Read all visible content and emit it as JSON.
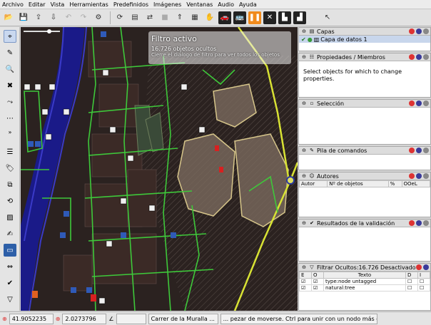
{
  "menu": [
    "Archivo",
    "Editar",
    "Vista",
    "Herramientas",
    "Predefinidos",
    "Imágenes",
    "Ventanas",
    "Audio",
    "Ayuda"
  ],
  "toolbar_icons": [
    "open-file-icon",
    "save-icon",
    "upload-icon",
    "download-icon",
    "undo-icon",
    "redo-icon",
    "preferences-icon",
    "update-icon",
    "filter-icon",
    "sync-icon",
    "clear-icon",
    "upload-osm-icon",
    "map-icon",
    "hand-icon",
    "car-icon",
    "bus-icon",
    "pause-icon",
    "close-icon",
    "building-icon",
    "factory-icon"
  ],
  "left_tools": [
    "select-icon",
    "draw-icon",
    "zoom-icon",
    "delete-icon",
    "split-icon",
    "combine-icon",
    "more-icon",
    "layers-icon",
    "tag-icon",
    "relation-icon",
    "history-icon",
    "map-paint-icon",
    "edit-icon",
    "notes-icon",
    "filter-icon",
    "validate-icon",
    "warning-icon"
  ],
  "map": {
    "filter_title": "Filtro activo",
    "filter_count": "16.726 objetos ocultos",
    "filter_hint": "Cierre el diálogo de filtro para ver todos los objetos"
  },
  "panels": {
    "layers": {
      "title": "Capas",
      "layer1": "Capa de datos 1"
    },
    "properties": {
      "title": "Propiedades / Miembros",
      "message": "Select objects for which to change properties."
    },
    "selection": {
      "title": "Selección"
    },
    "commands": {
      "title": "Pila de comandos"
    },
    "authors": {
      "title": "Autores",
      "cols": [
        "Autor",
        "Nº de objetos",
        "%",
        "OOeL"
      ]
    },
    "validation": {
      "title": "Resultados de la validación"
    },
    "filter": {
      "title": "Filtrar Ocultos:16.726 Desactivado",
      "cols": [
        "E",
        "O",
        "Texto",
        "D",
        "I"
      ],
      "rows": [
        {
          "text": "type:node untagged"
        },
        {
          "text": "natural:tree"
        }
      ]
    }
  },
  "status": {
    "lat": "41.9052235",
    "lon": "2.0273796",
    "angle": "",
    "street": "Carrer de la Muralla ...",
    "hint": "... pezar de moverse. Ctrl para unir con un nodo más cercano."
  }
}
